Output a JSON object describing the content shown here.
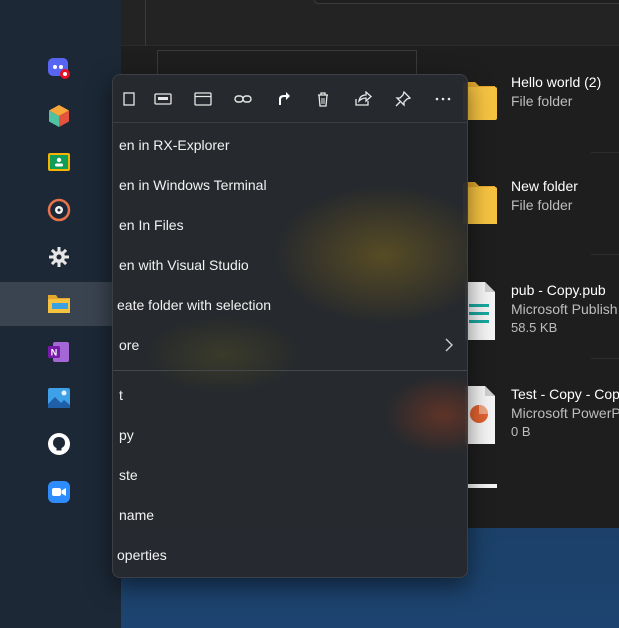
{
  "explorer": {
    "files": [
      {
        "name": "Hello world (2)",
        "type": "File folder",
        "size": "",
        "kind": "folder"
      },
      {
        "name": "New folder",
        "type": "File folder",
        "size": "",
        "kind": "folder"
      },
      {
        "name": "pub - Copy.pub",
        "type": "Microsoft Publish",
        "size": "58.5 KB",
        "kind": "publisher"
      },
      {
        "name": "Test - Copy - Cop",
        "type": "Microsoft PowerP",
        "size": "0 B",
        "kind": "powerpoint"
      }
    ]
  },
  "taskbar": {
    "items": [
      {
        "name": "discord",
        "icon": "discord-icon"
      },
      {
        "name": "cube-app",
        "icon": "cube-icon"
      },
      {
        "name": "classroom",
        "icon": "classroom-icon"
      },
      {
        "name": "music",
        "icon": "music-disc-icon"
      },
      {
        "name": "settings",
        "icon": "gear-icon"
      },
      {
        "name": "files",
        "icon": "folder-icon",
        "active": true
      },
      {
        "name": "onenote",
        "icon": "onenote-icon"
      },
      {
        "name": "photos",
        "icon": "photos-icon"
      },
      {
        "name": "github",
        "icon": "github-icon"
      },
      {
        "name": "zoom",
        "icon": "zoom-icon"
      }
    ]
  },
  "context_menu": {
    "toolbar": [
      "new-icon",
      "rename-box-icon",
      "window-icon",
      "link-icon",
      "shortcut-icon",
      "delete-icon",
      "share-icon",
      "pin-icon",
      "more-icon"
    ],
    "items": [
      {
        "label": "Open in RX-Explorer",
        "visible": "en in RX-Explorer"
      },
      {
        "label": "Open in Windows Terminal",
        "visible": "en in Windows Terminal"
      },
      {
        "label": "Open In Files",
        "visible": "en In Files"
      },
      {
        "label": "Open with Visual Studio",
        "visible": "en with Visual Studio"
      },
      {
        "label": "Create folder with selection",
        "visible": "eate folder with selection"
      },
      {
        "label": "More",
        "visible": "ore",
        "submenu": true
      },
      {
        "label": "Cut",
        "visible": "t"
      },
      {
        "label": "Copy",
        "visible": "py"
      },
      {
        "label": "Paste",
        "visible": "ste"
      },
      {
        "label": "Rename",
        "visible": "name"
      },
      {
        "label": "Properties",
        "visible": "operties"
      }
    ]
  },
  "colors": {
    "accent_folder": "#f6c341",
    "taskbar_bg": "#1c2836",
    "menu_bg": "#262a2e"
  }
}
